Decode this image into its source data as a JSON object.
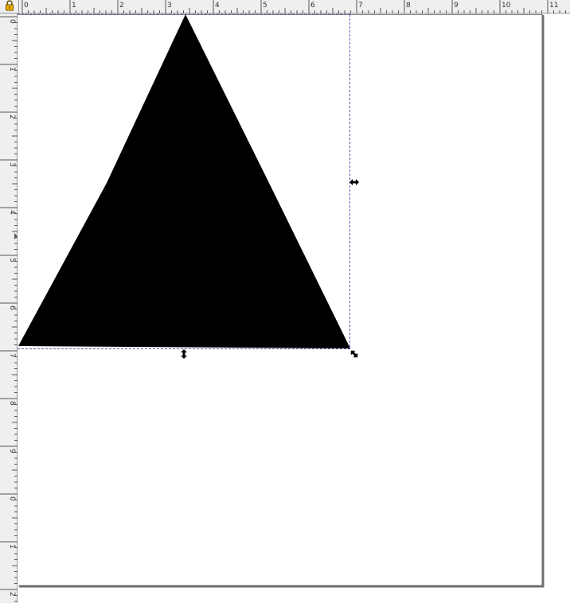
{
  "toolbar": {
    "lock_icon": "lock-icon"
  },
  "ruler": {
    "units": "in",
    "horizontal_labels": [
      "0",
      "1",
      "2",
      "3",
      "4",
      "5",
      "6",
      "7",
      "8",
      "9",
      "10",
      "11"
    ],
    "vertical_labels": [
      "0",
      "1",
      "2",
      "3",
      "4",
      "5",
      "6",
      "7",
      "8",
      "9",
      "0",
      "1",
      "2"
    ]
  },
  "page": {
    "background": "#ffffff",
    "border_color": "#6e6e6e"
  },
  "selection": {
    "shape": "triangle",
    "fill": "#000000",
    "bbox_guide_color": "#5b5bb5",
    "handles": [
      "resize-horizontal-handle-icon",
      "resize-vertical-handle-icon",
      "resize-diagonal-handle-icon"
    ]
  }
}
